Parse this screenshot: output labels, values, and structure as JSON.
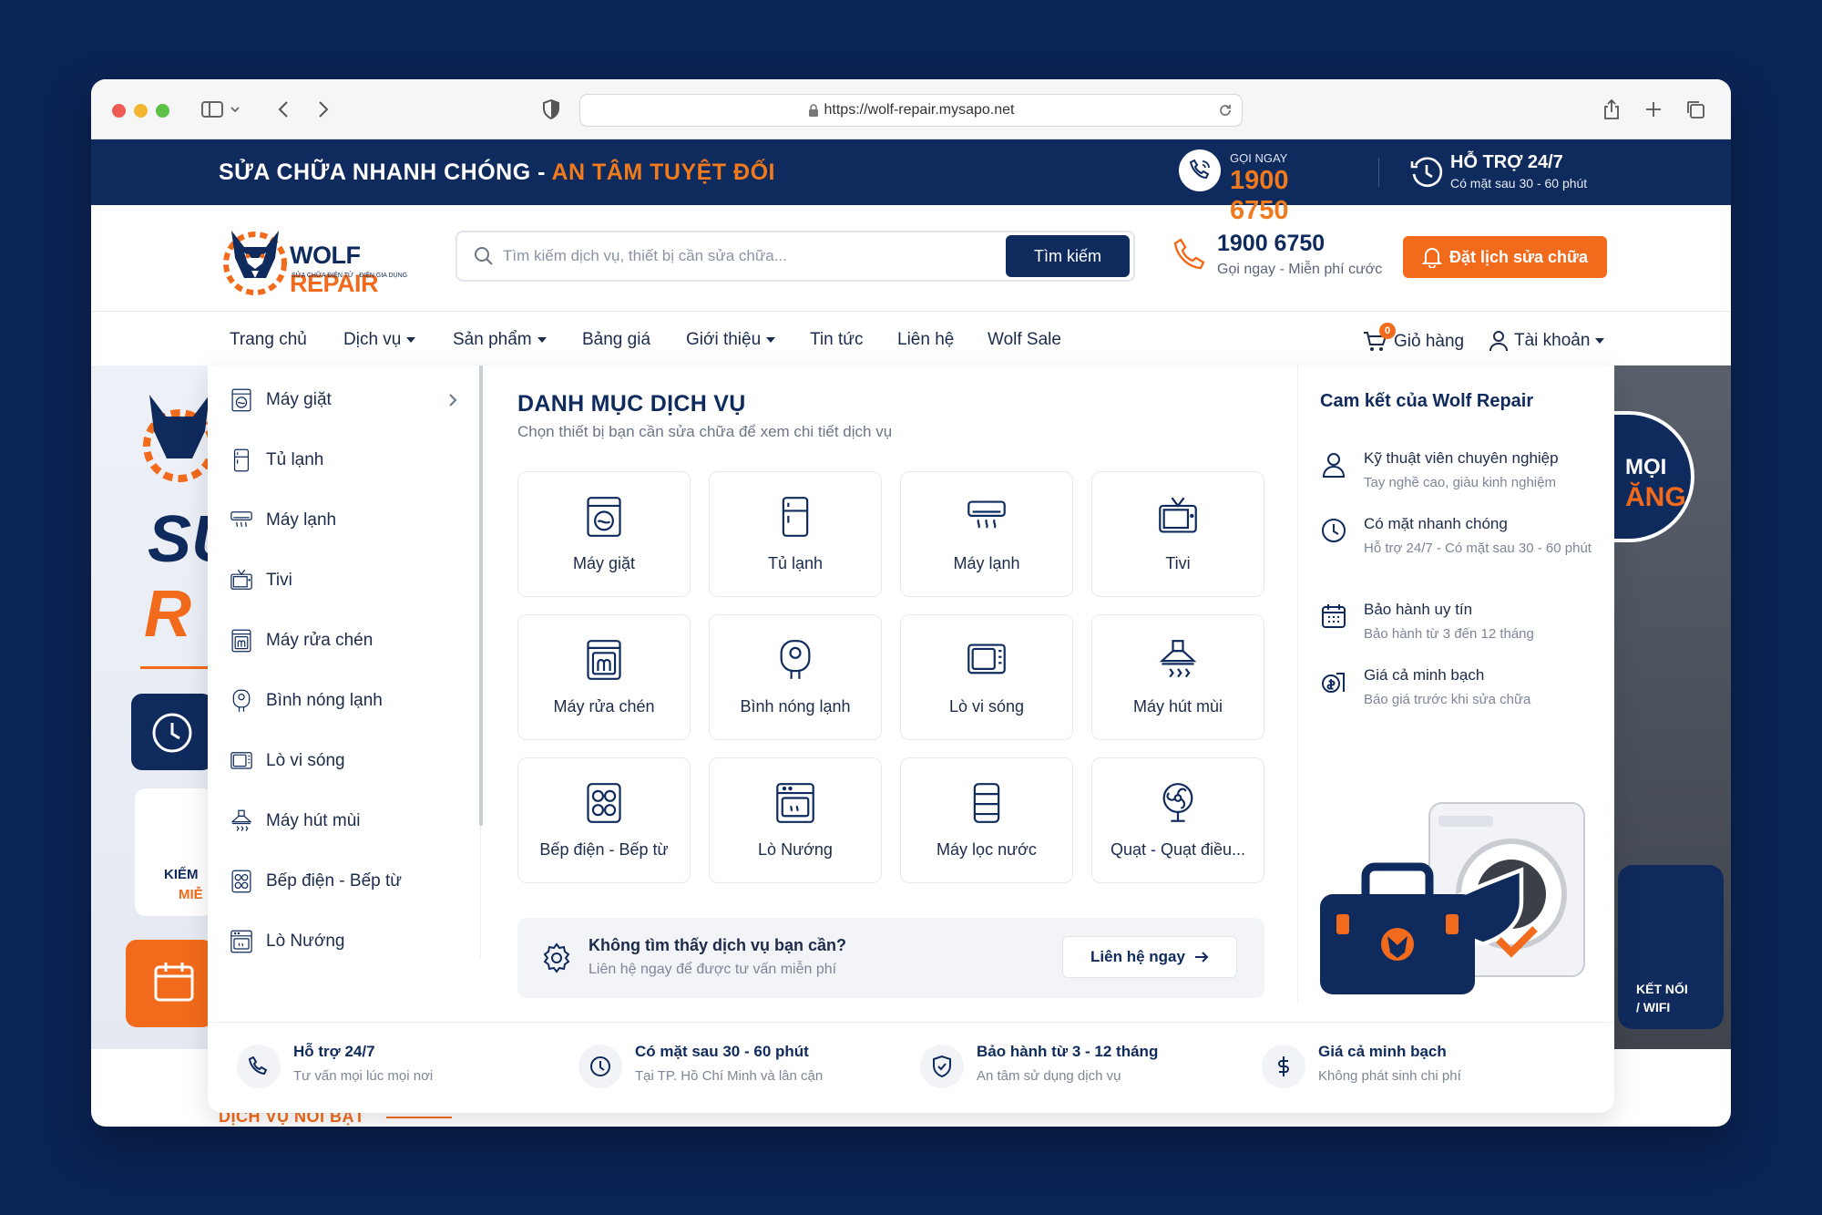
{
  "browser": {
    "url": "https://wolf-repair.mysapo.net"
  },
  "topbar": {
    "slogan_white": "SỬA CHỮA NHANH CHÓNG -",
    "slogan_orange": "AN TÂM TUYỆT ĐỐI",
    "call_label": "GỌI NGAY",
    "call_number": "1900 6750",
    "support_title": "HỖ TRỢ 24/7",
    "support_sub": "Có mặt sau 30 - 60 phút"
  },
  "header": {
    "logo_wolf": "WOLF",
    "logo_repair": "REPAIR",
    "logo_tagline": "SỬA CHỮA ĐIỆN TỬ · ĐIỆN GIA DỤNG",
    "search_placeholder": "Tìm kiếm dịch vụ, thiết bị cần sửa chữa...",
    "search_button": "Tìm kiếm",
    "hotline_number": "1900 6750",
    "hotline_sub": "Gọi ngay - Miễn phí cước",
    "book_button": "Đặt lịch sửa chữa"
  },
  "nav": {
    "items": [
      "Trang chủ",
      "Dịch vụ",
      "Sản phẩm",
      "Bảng giá",
      "Giới thiệu",
      "Tin tức",
      "Liên hệ",
      "Wolf Sale"
    ],
    "cart_label": "Giỏ hàng",
    "cart_count": "0",
    "account_label": "Tài khoản"
  },
  "sidebar": {
    "items": [
      "Máy giặt",
      "Tủ lạnh",
      "Máy lạnh",
      "Tivi",
      "Máy rửa chén",
      "Bình nóng lạnh",
      "Lò vi sóng",
      "Máy hút mùi",
      "Bếp điện - Bếp từ",
      "Lò Nướng"
    ]
  },
  "catalog": {
    "title": "DANH MỤC DỊCH VỤ",
    "subtitle": "Chọn thiết bị bạn cần sửa chữa để xem chi tiết dịch vụ",
    "cards": [
      {
        "label": "Máy giặt",
        "icon": "washer-icon"
      },
      {
        "label": "Tủ lạnh",
        "icon": "fridge-icon"
      },
      {
        "label": "Máy lạnh",
        "icon": "air-conditioner-icon"
      },
      {
        "label": "Tivi",
        "icon": "tv-icon"
      },
      {
        "label": "Máy rửa chén",
        "icon": "dishwasher-icon"
      },
      {
        "label": "Bình nóng lạnh",
        "icon": "water-heater-icon"
      },
      {
        "label": "Lò vi sóng",
        "icon": "microwave-icon"
      },
      {
        "label": "Máy hút mùi",
        "icon": "range-hood-icon"
      },
      {
        "label": "Bếp điện - Bếp từ",
        "icon": "cooktop-icon"
      },
      {
        "label": "Lò Nướng",
        "icon": "oven-icon"
      },
      {
        "label": "Máy lọc nước",
        "icon": "water-purifier-icon"
      },
      {
        "label": "Quạt - Quạt điều...",
        "icon": "fan-icon"
      }
    ],
    "notfound_title": "Không tìm thấy dịch vụ bạn cần?",
    "notfound_sub": "Liên hệ ngay để được tư vấn miễn phí",
    "contact_button": "Liên hệ ngay"
  },
  "commitment": {
    "title": "Cam kết của Wolf Repair",
    "items": [
      {
        "title": "Kỹ thuật viên chuyên nghiệp",
        "sub": "Tay nghề cao, giàu kinh nghiệm"
      },
      {
        "title": "Có mặt nhanh chóng",
        "sub": "Hỗ trợ 24/7 - Có mặt sau 30 - 60 phút"
      },
      {
        "title": "Bảo hành uy tín",
        "sub": "Bảo hành từ 3 đến 12 tháng"
      },
      {
        "title": "Giá cả minh bạch",
        "sub": "Báo giá trước khi sửa chữa"
      }
    ]
  },
  "features": [
    {
      "title": "Hỗ trợ 24/7",
      "sub": "Tư vấn mọi lúc mọi nơi"
    },
    {
      "title": "Có mặt sau 30 - 60 phút",
      "sub": "Tại TP. Hồ Chí Minh và lân cận"
    },
    {
      "title": "Bảo hành từ 3 - 12 tháng",
      "sub": "An tâm sử dụng dịch vụ"
    },
    {
      "title": "Giá cả minh bạch",
      "sub": "Không phát sinh chi phí"
    }
  ],
  "hero": {
    "left_partial_1": "SU",
    "left_partial_2": "R",
    "left_badge_1": "KIỂM",
    "left_badge_2": "MIỄ",
    "right_badge_1": "MỌI",
    "right_badge_2": "ĂNG",
    "right_card_1": "KẾT NỐI",
    "right_card_2": "/ WIFI",
    "section_heading": "DỊCH VỤ NỔI BẬT"
  },
  "colors": {
    "navy": "#0f2a5c",
    "orange": "#f26a1b",
    "background": "#0b2456"
  }
}
